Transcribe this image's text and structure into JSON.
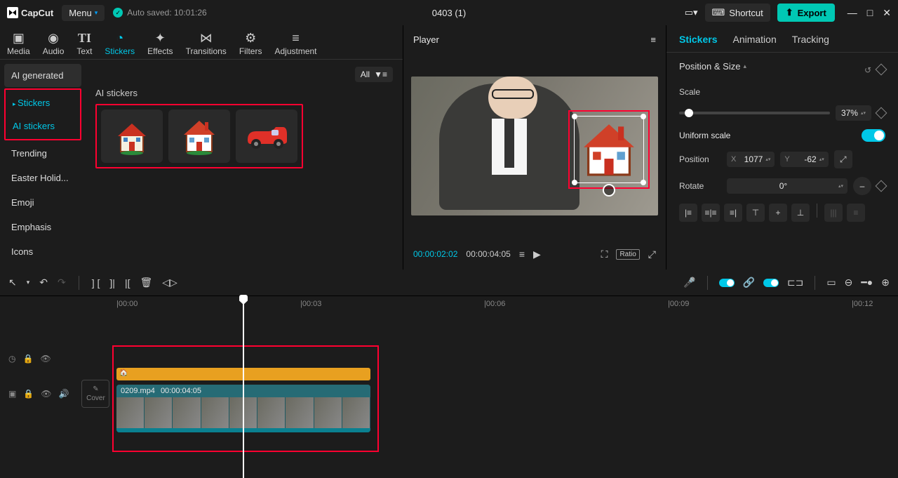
{
  "titlebar": {
    "appname": "CapCut",
    "menu": "Menu",
    "autosave": "Auto saved: 10:01:26",
    "title": "0403 (1)",
    "shortcut": "Shortcut",
    "export": "Export"
  },
  "tabs": {
    "media": "Media",
    "audio": "Audio",
    "text": "Text",
    "stickers": "Stickers",
    "effects": "Effects",
    "transitions": "Transitions",
    "filters": "Filters",
    "adjustment": "Adjustment"
  },
  "sidebar": {
    "aigen": "AI generated",
    "stickers": "Stickers",
    "aistickers": "AI stickers",
    "trending": "Trending",
    "easter": "Easter Holid...",
    "emoji": "Emoji",
    "emphasis": "Emphasis",
    "icons": "Icons"
  },
  "stickers": {
    "all": "All",
    "section": "AI stickers"
  },
  "player": {
    "label": "Player",
    "current": "00:00:02:02",
    "duration": "00:00:04:05",
    "ratio": "Ratio"
  },
  "props": {
    "tab_stickers": "Stickers",
    "tab_animation": "Animation",
    "tab_tracking": "Tracking",
    "section": "Position & Size",
    "scale_label": "Scale",
    "scale_value": "37%",
    "uniform": "Uniform scale",
    "position_label": "Position",
    "x_label": "X",
    "x_value": "1077",
    "y_label": "Y",
    "y_value": "-62",
    "rotate_label": "Rotate",
    "rotate_value": "0°",
    "dash": "–"
  },
  "timeline": {
    "ticks": [
      "|00:00",
      "|00:03",
      "|00:06",
      "|00:09",
      "|00:12"
    ],
    "clip_name": "0209.mp4",
    "clip_dur": "00:00:04:05",
    "cover": "Cover"
  }
}
